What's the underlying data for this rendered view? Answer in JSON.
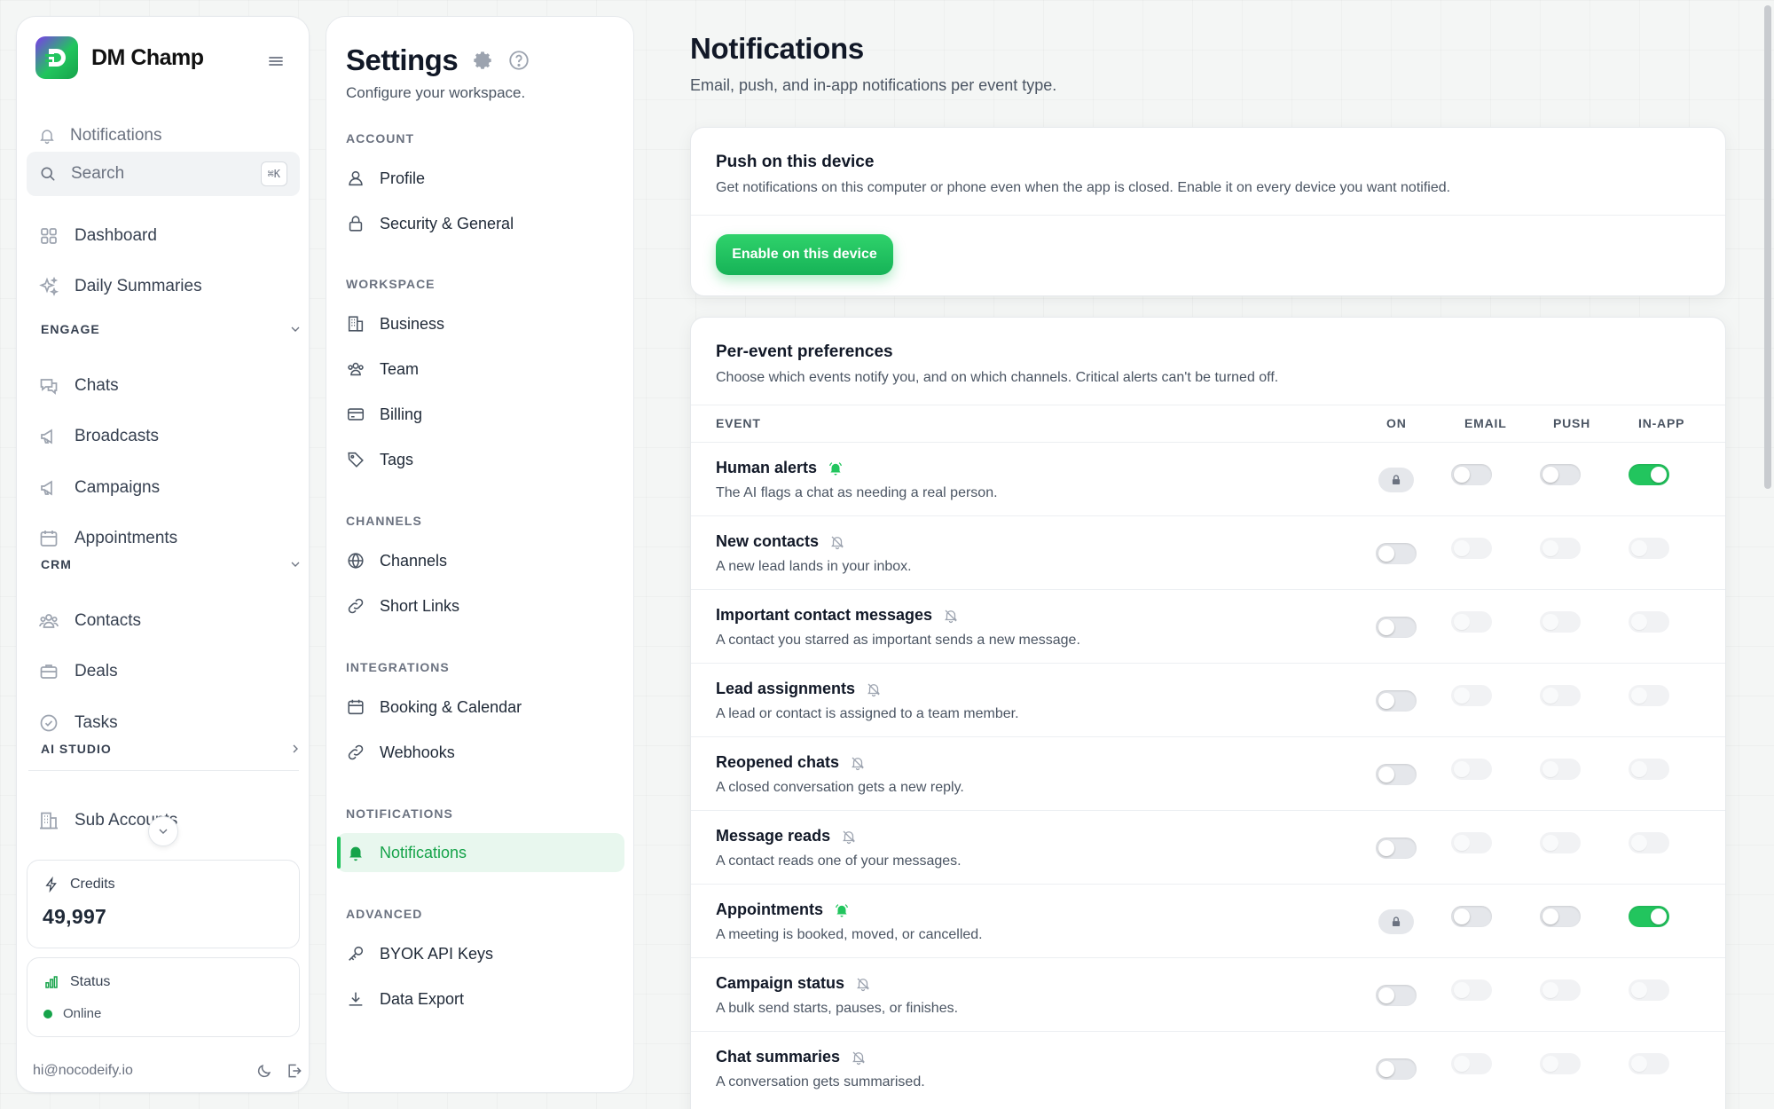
{
  "app": {
    "brand": "DM Champ"
  },
  "sidebar": {
    "notifications_label": "Notifications",
    "search_placeholder": "Search",
    "search_shortcut": "⌘K",
    "items": {
      "dashboard": "Dashboard",
      "daily_summaries": "Daily Summaries",
      "chats": "Chats",
      "broadcasts": "Broadcasts",
      "campaigns": "Campaigns",
      "appointments": "Appointments",
      "contacts": "Contacts",
      "deals": "Deals",
      "tasks": "Tasks",
      "sub_accounts": "Sub Accounts"
    },
    "sections": {
      "engage": "ENGAGE",
      "crm": "CRM",
      "ai_studio": "AI STUDIO"
    },
    "credits_label": "Credits",
    "credits_value": "49,997",
    "status_label": "Status",
    "status_value": "Online",
    "user_email": "hi@nocodeify.io"
  },
  "settings": {
    "title": "Settings",
    "subtitle": "Configure your workspace.",
    "groups": {
      "account": "ACCOUNT",
      "workspace": "WORKSPACE",
      "channels": "CHANNELS",
      "integrations": "INTEGRATIONS",
      "notifications": "NOTIFICATIONS",
      "advanced": "ADVANCED"
    },
    "items": {
      "profile": "Profile",
      "security": "Security & General",
      "business": "Business",
      "team": "Team",
      "billing": "Billing",
      "tags": "Tags",
      "channels": "Channels",
      "short_links": "Short Links",
      "booking": "Booking & Calendar",
      "webhooks": "Webhooks",
      "notifications": "Notifications",
      "byok": "BYOK API Keys",
      "data_export": "Data Export"
    }
  },
  "main": {
    "title": "Notifications",
    "subtitle": "Email, push, and in-app notifications per event type.",
    "push": {
      "title": "Push on this device",
      "description": "Get notifications on this computer or phone even when the app is closed. Enable it on every device you want notified.",
      "button": "Enable on this device"
    },
    "prefs": {
      "title": "Per-event preferences",
      "description": "Choose which events notify you, and on which channels. Critical alerts can't be turned off.",
      "columns": {
        "event": "EVENT",
        "on": "ON",
        "email": "EMAIL",
        "push": "PUSH",
        "inapp": "IN-APP"
      },
      "events": [
        {
          "name": "Human alerts",
          "desc": "The AI flags a chat as needing a real person.",
          "locked": true,
          "on": true,
          "email": false,
          "push": false,
          "inapp": true
        },
        {
          "name": "New contacts",
          "desc": "A new lead lands in your inbox.",
          "locked": false,
          "on": false,
          "email": false,
          "push": false,
          "inapp": false
        },
        {
          "name": "Important contact messages",
          "desc": "A contact you starred as important sends a new message.",
          "locked": false,
          "on": false,
          "email": false,
          "push": false,
          "inapp": false
        },
        {
          "name": "Lead assignments",
          "desc": "A lead or contact is assigned to a team member.",
          "locked": false,
          "on": false,
          "email": false,
          "push": false,
          "inapp": false
        },
        {
          "name": "Reopened chats",
          "desc": "A closed conversation gets a new reply.",
          "locked": false,
          "on": false,
          "email": false,
          "push": false,
          "inapp": false
        },
        {
          "name": "Message reads",
          "desc": "A contact reads one of your messages.",
          "locked": false,
          "on": false,
          "email": false,
          "push": false,
          "inapp": false
        },
        {
          "name": "Appointments",
          "desc": "A meeting is booked, moved, or cancelled.",
          "locked": true,
          "on": true,
          "email": false,
          "push": false,
          "inapp": true
        },
        {
          "name": "Campaign status",
          "desc": "A bulk send starts, pauses, or finishes.",
          "locked": false,
          "on": false,
          "email": false,
          "push": false,
          "inapp": false
        },
        {
          "name": "Chat summaries",
          "desc": "A conversation gets summarised.",
          "locked": false,
          "on": false,
          "email": false,
          "push": false,
          "inapp": false
        }
      ]
    }
  },
  "colors": {
    "accent": "#22c55e",
    "accent_dark": "#16a34a",
    "text": "#111827",
    "muted": "#4b5563"
  }
}
